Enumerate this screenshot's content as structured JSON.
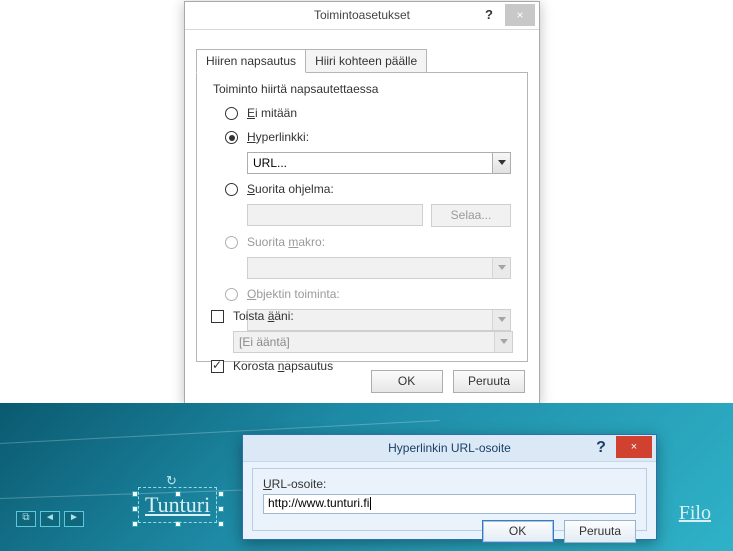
{
  "dialog1": {
    "title": "Toimintoasetukset",
    "help": "?",
    "close": "×",
    "tabs": {
      "active": "Hiiren napsautus",
      "inactive": "Hiiri kohteen päälle"
    },
    "group_title": "Toiminto hiirtä napsautettaessa",
    "options": {
      "none": {
        "text": "Ei mitään",
        "key": "E"
      },
      "hyperlink": {
        "text": "Hyperlinkki:",
        "key": "H",
        "value": "URL..."
      },
      "run_program": {
        "text": "Suorita ohjelma:",
        "key": "S",
        "browse": "Selaa..."
      },
      "run_macro": {
        "text": "Suorita makro:",
        "key": "m"
      },
      "object_action": {
        "text": "Objektin toiminta:",
        "key": "O"
      }
    },
    "sound": {
      "label": "Toista ääni:",
      "key": "ä",
      "value": "[Ei ääntä]"
    },
    "highlight": {
      "label": "Korosta napsautus",
      "key": "n"
    },
    "buttons": {
      "ok": "OK",
      "cancel": "Peruuta"
    }
  },
  "dialog2": {
    "title": "Hyperlinkin URL-osoite",
    "help": "?",
    "close": "×",
    "label": "URL-osoite:",
    "value": "http://www.tunturi.fi",
    "ok": "OK",
    "cancel": "Peruuta"
  },
  "slide": {
    "link1": "Tunturi",
    "link2": "Filo"
  }
}
